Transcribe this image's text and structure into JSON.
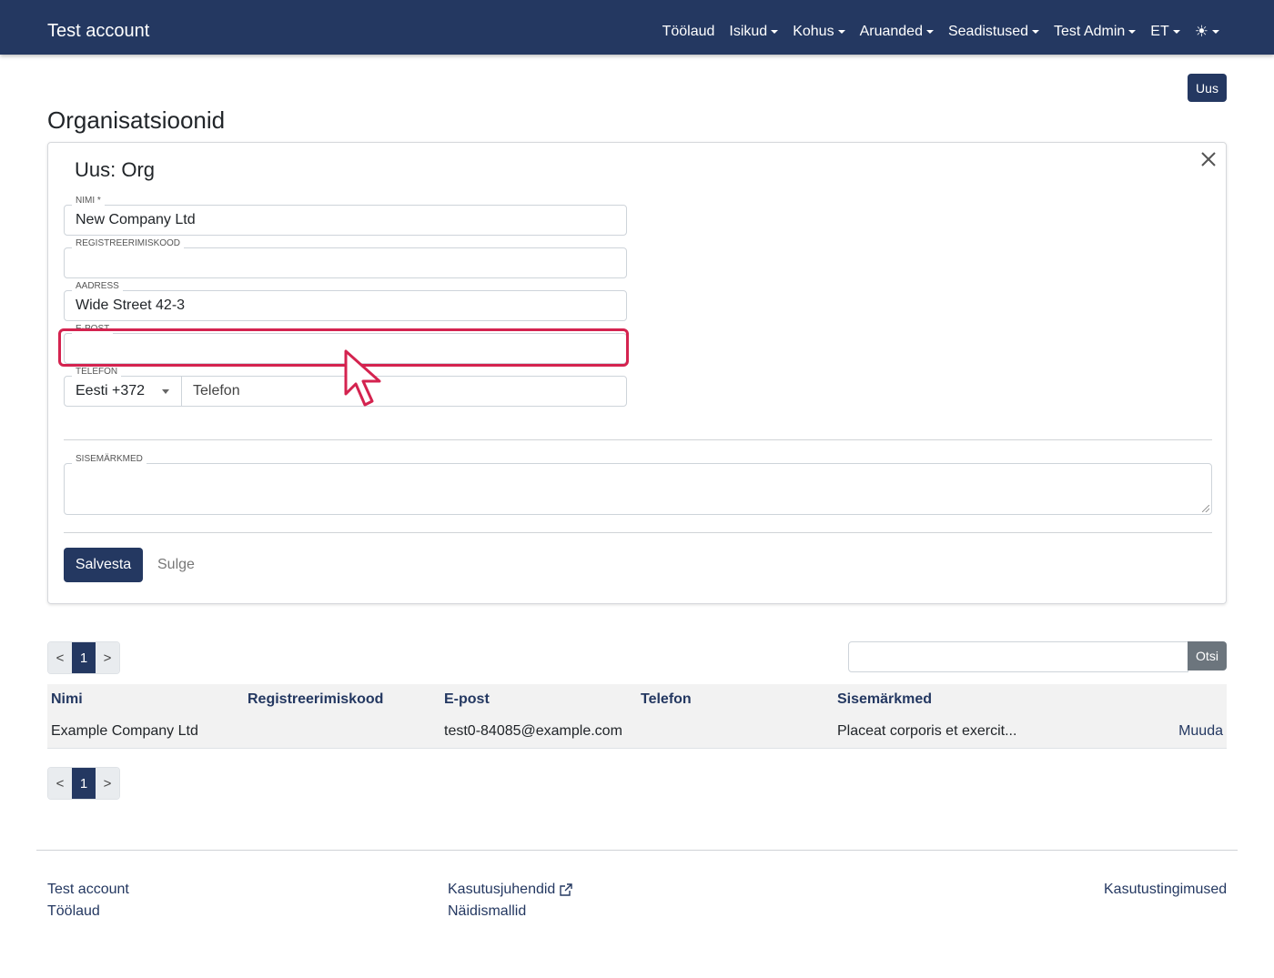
{
  "navbar": {
    "brand": "Test account",
    "items": [
      {
        "label": "Töölaud",
        "dropdown": false
      },
      {
        "label": "Isikud",
        "dropdown": true
      },
      {
        "label": "Kohus",
        "dropdown": true
      },
      {
        "label": "Aruanded",
        "dropdown": true
      },
      {
        "label": "Seadistused",
        "dropdown": true
      },
      {
        "label": "Test Admin",
        "dropdown": true
      },
      {
        "label": "ET",
        "dropdown": true
      }
    ],
    "theme_icon": "☀"
  },
  "page": {
    "new_button": "Uus",
    "title": "Organisatsioonid"
  },
  "form": {
    "title": "Uus: Org",
    "fields": {
      "name": {
        "label": "Nimi *",
        "value": "New Company Ltd"
      },
      "regcode": {
        "label": "Registreerimiskood",
        "value": ""
      },
      "address": {
        "label": "Aadress",
        "value": "Wide Street 42-3"
      },
      "email": {
        "label": "E-post",
        "value": ""
      },
      "phone": {
        "label": "Telefon",
        "country": "Eesti +372",
        "placeholder": "Telefon"
      },
      "notes": {
        "label": "Sisemärkmed",
        "value": ""
      }
    },
    "save_label": "Salvesta",
    "close_label": "Sulge"
  },
  "pagination": {
    "prev": "<",
    "current": "1",
    "next": ">"
  },
  "search": {
    "value": "",
    "button": "Otsi"
  },
  "table": {
    "headers": [
      "Nimi",
      "Registreerimiskood",
      "E-post",
      "Telefon",
      "Sisemärkmed"
    ],
    "rows": [
      {
        "name": "Example Company Ltd",
        "regcode": "",
        "email": "test0-84085@example.com",
        "phone": "",
        "notes": "Placeat corporis et exercit...",
        "action": "Muuda"
      }
    ]
  },
  "footer": {
    "col1": [
      "Test account",
      "Töölaud"
    ],
    "col2": [
      "Kasutusjuhendid",
      "Näidismallid"
    ],
    "col3": [
      "Kasutustingimused"
    ]
  },
  "colors": {
    "primary": "#243861",
    "highlight": "#d4234f",
    "secondary": "#6c757d"
  }
}
